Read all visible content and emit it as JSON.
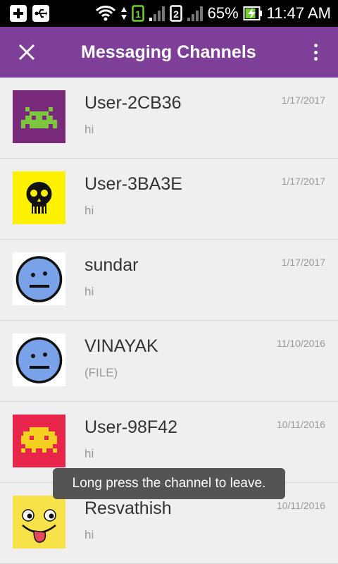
{
  "status_bar": {
    "battery_percent": "65%",
    "time": "11:47 AM",
    "sim1_label": "1",
    "sim2_label": "2",
    "icons": [
      "plus-icon",
      "usb-icon",
      "wifi-icon",
      "sim1-icon",
      "signal-icon",
      "sim2-icon",
      "signal-icon",
      "battery-charging-icon"
    ]
  },
  "app_bar": {
    "title": "Messaging Channels",
    "close_icon": "close-icon",
    "menu_icon": "overflow-menu-icon",
    "color": "#7d3f98"
  },
  "channels": [
    {
      "name": "User-2CB36",
      "date": "1/17/2017",
      "message": "hi",
      "avatar": "space-invader-green-icon",
      "avatar_bg": "#7a2a7a"
    },
    {
      "name": "User-3BA3E",
      "date": "1/17/2017",
      "message": "hi",
      "avatar": "skull-icon",
      "avatar_bg": "#fff200"
    },
    {
      "name": "sundar",
      "date": "1/17/2017",
      "message": "hi",
      "avatar": "blue-face-icon",
      "avatar_bg": "#ffffff"
    },
    {
      "name": "VINAYAK",
      "date": "11/10/2016",
      "message": "(FILE)",
      "avatar": "blue-face-icon",
      "avatar_bg": "#ffffff"
    },
    {
      "name": "User-98F42",
      "date": "10/11/2016",
      "message": "hi",
      "avatar": "space-invader-yellow-icon",
      "avatar_bg": "#e8254a"
    },
    {
      "name": "Resvathish",
      "date": "10/11/2016",
      "message": "hi",
      "avatar": "tongue-face-icon",
      "avatar_bg": "#f7e24a"
    }
  ],
  "toast": {
    "text": "Long press the channel to leave."
  }
}
